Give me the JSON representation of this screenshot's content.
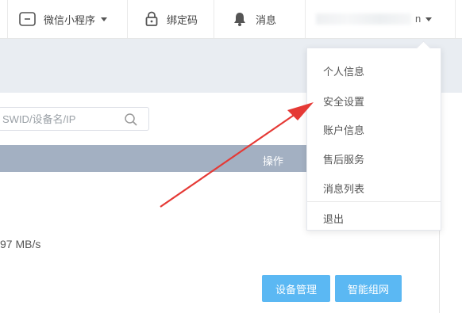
{
  "topbar": {
    "mini_program_label": "微信小程序",
    "bind_code_label": "绑定码",
    "messages_label": "消息",
    "user_suffix": "n"
  },
  "search": {
    "placeholder": "SWID/设备名/IP"
  },
  "table": {
    "header_operation": "操作"
  },
  "row": {
    "speed_text": "97 MB/s"
  },
  "buttons": {
    "device_manage": "设备管理",
    "smart_network": "智能组网"
  },
  "user_menu": {
    "items": [
      "个人信息",
      "安全设置",
      "账户信息",
      "售后服务",
      "消息列表"
    ],
    "logout": "退出"
  },
  "colors": {
    "header_bg": "#a3b0c2",
    "button_bg": "#5bb8f3",
    "annotation_arrow": "#e53935"
  }
}
